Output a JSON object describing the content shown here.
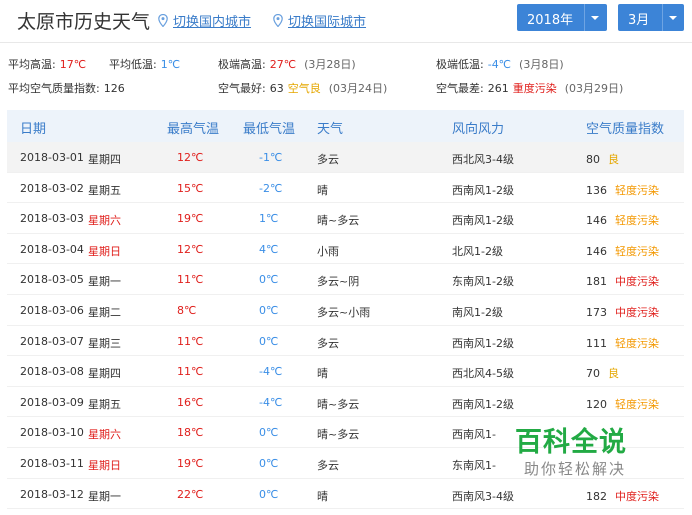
{
  "header": {
    "title": "太原市历史天气",
    "links": {
      "domestic": "切换国内城市",
      "international": "切换国际城市"
    },
    "year_select": {
      "value": "2018年"
    },
    "month_select": {
      "value": "3月"
    }
  },
  "stats": {
    "avg_high": {
      "label": "平均高温:",
      "value": "17℃"
    },
    "avg_low": {
      "label": "平均低温:",
      "value": "1℃"
    },
    "extreme_high": {
      "label": "极端高温:",
      "value": "27℃",
      "date": "(3月28日)"
    },
    "extreme_low": {
      "label": "极端低温:",
      "value": "-4℃",
      "date": "(3月8日)"
    },
    "avg_aqi": {
      "label": "平均空气质量指数:",
      "value": "126"
    },
    "best_air": {
      "label": "空气最好:",
      "value": "63",
      "level": "空气良",
      "date": "(03月24日)"
    },
    "worst_air": {
      "label": "空气最差:",
      "value": "261",
      "level": "重度污染",
      "date": "(03月29日)"
    }
  },
  "table": {
    "headers": [
      "日期",
      "最高气温",
      "最低气温",
      "天气",
      "风向风力",
      "空气质量指数"
    ],
    "rows": [
      {
        "date": "2018-03-01",
        "week": "星期四",
        "max": "12℃",
        "min": "-1℃",
        "weather": "多云",
        "wind": "西北风3-4级",
        "aqi": "80",
        "level": "良"
      },
      {
        "date": "2018-03-02",
        "week": "星期五",
        "max": "15℃",
        "min": "-2℃",
        "weather": "晴",
        "wind": "西南风1-2级",
        "aqi": "136",
        "level": "轻度污染"
      },
      {
        "date": "2018-03-03",
        "week": "星期六",
        "max": "19℃",
        "min": "1℃",
        "weather": "晴~多云",
        "wind": "西南风1-2级",
        "aqi": "146",
        "level": "轻度污染"
      },
      {
        "date": "2018-03-04",
        "week": "星期日",
        "max": "12℃",
        "min": "4℃",
        "weather": "小雨",
        "wind": "北风1-2级",
        "aqi": "146",
        "level": "轻度污染"
      },
      {
        "date": "2018-03-05",
        "week": "星期一",
        "max": "11℃",
        "min": "0℃",
        "weather": "多云~阴",
        "wind": "东南风1-2级",
        "aqi": "181",
        "level": "中度污染"
      },
      {
        "date": "2018-03-06",
        "week": "星期二",
        "max": "8℃",
        "min": "0℃",
        "weather": "多云~小雨",
        "wind": "南风1-2级",
        "aqi": "173",
        "level": "中度污染"
      },
      {
        "date": "2018-03-07",
        "week": "星期三",
        "max": "11℃",
        "min": "0℃",
        "weather": "多云",
        "wind": "西南风1-2级",
        "aqi": "111",
        "level": "轻度污染"
      },
      {
        "date": "2018-03-08",
        "week": "星期四",
        "max": "11℃",
        "min": "-4℃",
        "weather": "晴",
        "wind": "西北风4-5级",
        "aqi": "70",
        "level": "良"
      },
      {
        "date": "2018-03-09",
        "week": "星期五",
        "max": "16℃",
        "min": "-4℃",
        "weather": "晴~多云",
        "wind": "西南风1-2级",
        "aqi": "120",
        "level": "轻度污染"
      },
      {
        "date": "2018-03-10",
        "week": "星期六",
        "max": "18℃",
        "min": "0℃",
        "weather": "晴~多云",
        "wind": "西南风1-",
        "aqi": "",
        "level": ""
      },
      {
        "date": "2018-03-11",
        "week": "星期日",
        "max": "19℃",
        "min": "0℃",
        "weather": "多云",
        "wind": "东南风1-",
        "aqi": "",
        "level": ""
      },
      {
        "date": "2018-03-12",
        "week": "星期一",
        "max": "22℃",
        "min": "0℃",
        "weather": "晴",
        "wind": "西南风3-4级",
        "aqi": "182",
        "level": "中度污染"
      }
    ]
  },
  "watermark": {
    "title": "百科全说",
    "subtitle": "助你轻松解决"
  },
  "colors": {
    "link": "#3a7cc9",
    "select_bg": "#3c84d7",
    "high_temp": "#e0201d",
    "low_temp": "#3a8ee6",
    "aqi_good": "#e5a700",
    "aqi_light": "#f39800",
    "aqi_moderate": "#e0201d",
    "watermark": "#22aa44"
  }
}
